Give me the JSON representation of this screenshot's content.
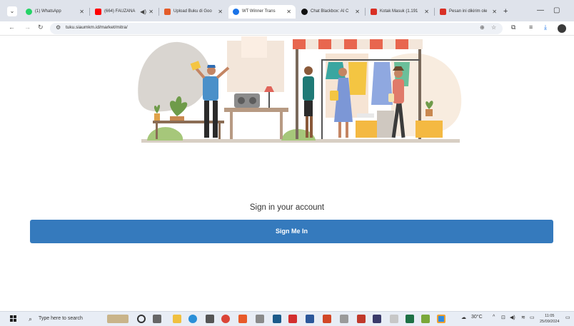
{
  "browser": {
    "tabs": [
      {
        "label": "(1) WhatsApp",
        "favicon_color": "#25d366",
        "active": false
      },
      {
        "label": "(664) FAUZANA",
        "favicon_color": "#ff0000",
        "active": false
      },
      {
        "label": "Upload Buku di Goo",
        "favicon_color": "#e45c2a",
        "active": false
      },
      {
        "label": "WT Winner Trans",
        "favicon_color": "#1a73e8",
        "active": true
      },
      {
        "label": "Chat Blackbox: AI C",
        "favicon_color": "#111111",
        "active": false
      },
      {
        "label": "Kotak Masuk (1.191",
        "favicon_color": "#d93025",
        "active": false
      },
      {
        "label": "Pesan ini dikirim ole",
        "favicon_color": "#d93025",
        "active": false
      }
    ],
    "url": "tuku.siaumkm.id/market/mitra/"
  },
  "page": {
    "signin_title": "Sign in your account",
    "signin_button": "Sign Me In"
  },
  "taskbar": {
    "search_placeholder": "Type here to search",
    "weather": "30°C",
    "time": "11:05",
    "date": "25/09/2024"
  }
}
